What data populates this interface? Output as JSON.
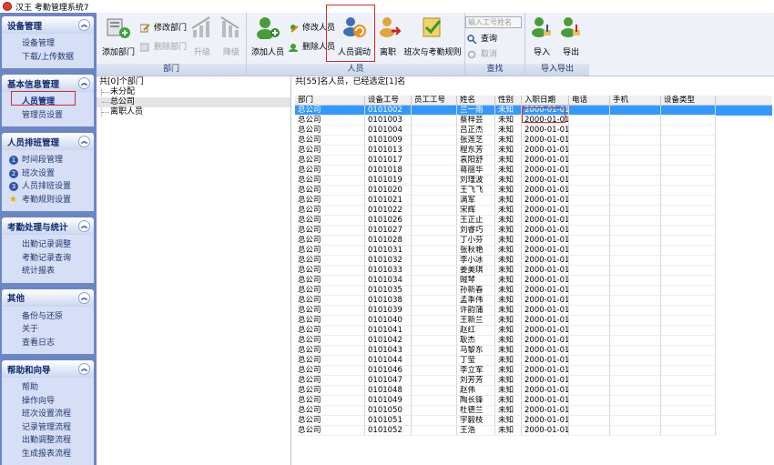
{
  "window": {
    "title": "汉王 考勤管理系统7"
  },
  "sidebar": {
    "groups": [
      {
        "title": "设备管理",
        "items": [
          "设备管理",
          "下载/上传数据"
        ]
      },
      {
        "title": "基本信息管理",
        "items": [
          "人员管理",
          "管理员设置"
        ]
      },
      {
        "title": "人员排班管理",
        "items": [
          "时间段管理",
          "班次设置",
          "人员排班设置",
          "考勤规则设置"
        ]
      },
      {
        "title": "考勤处理与统计",
        "items": [
          "出勤记录调整",
          "考勤记录查询",
          "统计报表"
        ]
      },
      {
        "title": "其他",
        "items": [
          "备份与还原",
          "关于",
          "查看日志"
        ]
      },
      {
        "title": "帮助和向导",
        "items": [
          "帮助",
          "操作向导",
          "班次设置流程",
          "记录管理流程",
          "出勤调整流程",
          "生成报表流程"
        ]
      }
    ]
  },
  "toolbar": {
    "dept": {
      "label": "部门",
      "add": "添加部门",
      "edit": "修改部门",
      "delete": "删除部门",
      "upgrade": "升级",
      "downgrade": "降级"
    },
    "person": {
      "label": "人员",
      "add": "添加人员",
      "edit": "修改人员",
      "delete": "删除人员",
      "transfer": "人员调动",
      "leave": "离职",
      "shift_rule": "班次与考勤规则"
    },
    "search": {
      "label": "查找",
      "placeholder": "输入工号姓名",
      "query": "查询",
      "cancel": "取消"
    },
    "io": {
      "label": "导入导出",
      "import": "导入",
      "export": "导出"
    }
  },
  "tree": {
    "header": "共[0]个部门",
    "nodes": [
      "未分配",
      "总公司",
      "离职人员"
    ]
  },
  "grid": {
    "info": "共[55]名人员，已经选定[1]名",
    "columns": [
      "部门",
      "设备工号",
      "员工工号",
      "姓名",
      "性别",
      "入职日期",
      "电话",
      "手机",
      "设备类型"
    ],
    "rows": [
      [
        "总公司",
        "0101002",
        "",
        "兰一雨",
        "未知",
        "2000-01-01"
      ],
      [
        "总公司",
        "0101003",
        "",
        "蔡梓芸",
        "未知",
        "2000-01-01"
      ],
      [
        "总公司",
        "0101004",
        "",
        "吕正杰",
        "未知",
        "2000-01-01"
      ],
      [
        "总公司",
        "0101009",
        "",
        "张莲芝",
        "未知",
        "2000-01-01"
      ],
      [
        "总公司",
        "0101013",
        "",
        "程东芳",
        "未知",
        "2000-01-01"
      ],
      [
        "总公司",
        "0101017",
        "",
        "袁阳舒",
        "未知",
        "2000-01-01"
      ],
      [
        "总公司",
        "0101018",
        "",
        "蒋丽华",
        "未知",
        "2000-01-01"
      ],
      [
        "总公司",
        "0101019",
        "",
        "刘瑾波",
        "未知",
        "2000-01-01"
      ],
      [
        "总公司",
        "0101020",
        "",
        "王飞飞",
        "未知",
        "2000-01-01"
      ],
      [
        "总公司",
        "0101021",
        "",
        "满军",
        "未知",
        "2000-01-01"
      ],
      [
        "总公司",
        "0101022",
        "",
        "宋辉",
        "未知",
        "2000-01-01"
      ],
      [
        "总公司",
        "0101026",
        "",
        "王正止",
        "未知",
        "2000-01-01"
      ],
      [
        "总公司",
        "0101027",
        "",
        "刘睿巧",
        "未知",
        "2000-01-01"
      ],
      [
        "总公司",
        "0101028",
        "",
        "丁小芬",
        "未知",
        "2000-01-01"
      ],
      [
        "总公司",
        "0101031",
        "",
        "张秋艳",
        "未知",
        "2000-01-01"
      ],
      [
        "总公司",
        "0101032",
        "",
        "李小冰",
        "未知",
        "2000-01-01"
      ],
      [
        "总公司",
        "0101033",
        "",
        "姜美琪",
        "未知",
        "2000-01-01"
      ],
      [
        "总公司",
        "0101034",
        "",
        "贼琴",
        "未知",
        "2000-01-01"
      ],
      [
        "总公司",
        "0101035",
        "",
        "孙新春",
        "未知",
        "2000-01-01"
      ],
      [
        "总公司",
        "0101038",
        "",
        "孟季伟",
        "未知",
        "2000-01-01"
      ],
      [
        "总公司",
        "0101039",
        "",
        "许韵蒲",
        "未知",
        "2000-01-01"
      ],
      [
        "总公司",
        "0101040",
        "",
        "王新兰",
        "未知",
        "2000-01-01"
      ],
      [
        "总公司",
        "0101041",
        "",
        "赵红",
        "未知",
        "2000-01-01"
      ],
      [
        "总公司",
        "0101042",
        "",
        "耿杰",
        "未知",
        "2000-01-01"
      ],
      [
        "总公司",
        "0101043",
        "",
        "马黎东",
        "未知",
        "2000-01-01"
      ],
      [
        "总公司",
        "0101044",
        "",
        "丁莹",
        "未知",
        "2000-01-01"
      ],
      [
        "总公司",
        "0101046",
        "",
        "李立军",
        "未知",
        "2000-01-01"
      ],
      [
        "总公司",
        "0101047",
        "",
        "刘芳芳",
        "未知",
        "2000-01-01"
      ],
      [
        "总公司",
        "0101048",
        "",
        "赵伟",
        "未知",
        "2000-01-01"
      ],
      [
        "总公司",
        "0101049",
        "",
        "陶长锋",
        "未知",
        "2000-01-01"
      ],
      [
        "总公司",
        "0101050",
        "",
        "杜德兰",
        "未知",
        "2000-01-01"
      ],
      [
        "总公司",
        "0101051",
        "",
        "宇毅枝",
        "未知",
        "2000-01-01"
      ],
      [
        "总公司",
        "0101052",
        "",
        "王浩",
        "未知",
        "2000-01-01"
      ]
    ]
  }
}
